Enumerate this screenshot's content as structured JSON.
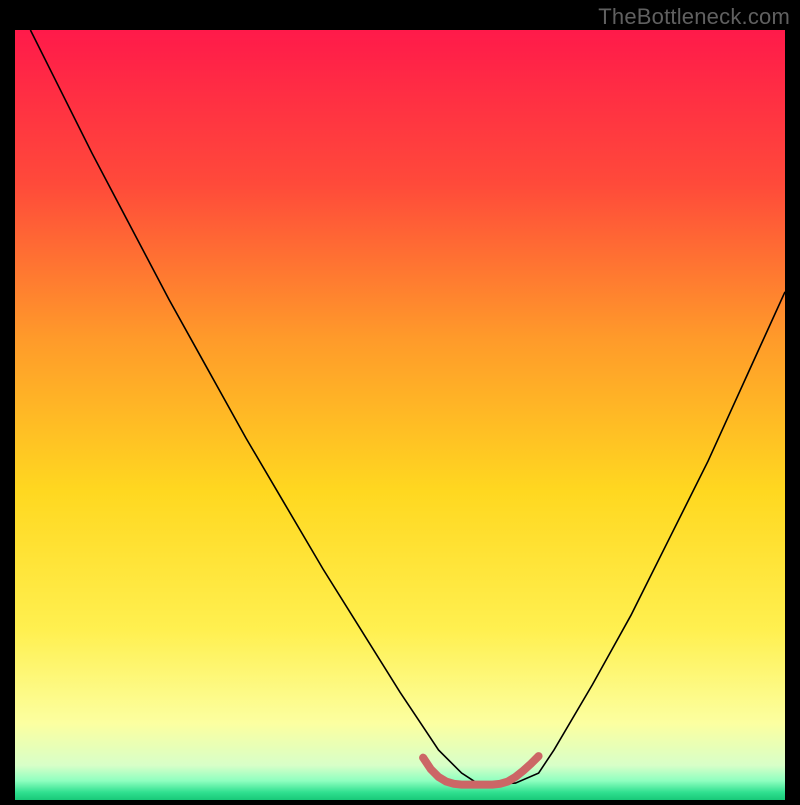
{
  "watermark": "TheBottleneck.com",
  "chart_data": {
    "type": "line",
    "title": "",
    "xlabel": "",
    "ylabel": "",
    "xlim": [
      0,
      100
    ],
    "ylim": [
      0,
      100
    ],
    "background_gradient": {
      "stops": [
        {
          "offset": 0.0,
          "color": "#ff1a4a"
        },
        {
          "offset": 0.2,
          "color": "#ff4a3a"
        },
        {
          "offset": 0.4,
          "color": "#ff9a2a"
        },
        {
          "offset": 0.6,
          "color": "#ffd820"
        },
        {
          "offset": 0.78,
          "color": "#fff050"
        },
        {
          "offset": 0.9,
          "color": "#fcffa0"
        },
        {
          "offset": 0.955,
          "color": "#d8ffc8"
        },
        {
          "offset": 0.975,
          "color": "#8fffc0"
        },
        {
          "offset": 0.99,
          "color": "#30e090"
        },
        {
          "offset": 1.0,
          "color": "#18c878"
        }
      ]
    },
    "series": [
      {
        "name": "bottleneck-curve",
        "color": "#000000",
        "stroke_width": 1.6,
        "x": [
          2,
          5,
          10,
          15,
          20,
          25,
          30,
          35,
          40,
          45,
          50,
          53,
          55,
          58,
          60,
          63,
          65,
          68,
          70,
          75,
          80,
          85,
          90,
          95,
          100
        ],
        "y": [
          100,
          94,
          84,
          74.5,
          65,
          56,
          47,
          38.5,
          30,
          22,
          14,
          9.5,
          6.5,
          3.5,
          2.2,
          2.1,
          2.2,
          3.5,
          6.5,
          15,
          24,
          34,
          44,
          55,
          66
        ]
      },
      {
        "name": "optimal-range-marker",
        "color": "#cc6666",
        "stroke_width": 8,
        "stroke_linecap": "round",
        "x": [
          53,
          54,
          55,
          56,
          57,
          58,
          59,
          60,
          61,
          62,
          63,
          64,
          65,
          66,
          67,
          68
        ],
        "y": [
          5.5,
          4.0,
          3.0,
          2.4,
          2.1,
          2.0,
          2.0,
          2.0,
          2.0,
          2.0,
          2.1,
          2.4,
          3.0,
          3.8,
          4.7,
          5.7
        ]
      }
    ]
  }
}
